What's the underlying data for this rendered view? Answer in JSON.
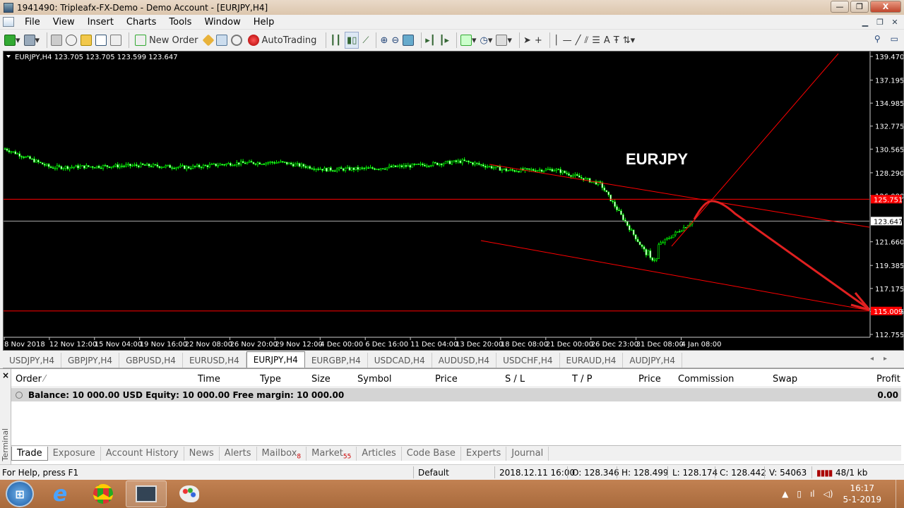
{
  "window": {
    "title": "1941490: Tripleafx-FX-Demo - Demo Account - [EURJPY,H4]",
    "min": "—",
    "max": "❐",
    "close": "X"
  },
  "menu": [
    "File",
    "View",
    "Insert",
    "Charts",
    "Tools",
    "Window",
    "Help"
  ],
  "toolbar": {
    "new_order": "New Order",
    "autotrading": "AutoTrading",
    "text_tool": "A"
  },
  "chart": {
    "header": "EURJPY,H4  123.705 123.705 123.599 123.647",
    "watermark": "EURJPY",
    "price_labels": [
      "139.470",
      "137.195",
      "134.985",
      "132.775",
      "130.565",
      "128.290",
      "126.080",
      "123.647",
      "121.660",
      "119.385",
      "117.175",
      "114.965",
      "112.755"
    ],
    "current_price": "123.647",
    "hline_upper": "125.751",
    "hline_lower": "115.009",
    "time_labels": [
      "8 Nov 2018",
      "12 Nov 12:00",
      "15 Nov 04:00",
      "19 Nov 16:00",
      "22 Nov 08:00",
      "26 Nov 20:00",
      "29 Nov 12:00",
      "4 Dec 00:00",
      "6 Dec 16:00",
      "11 Dec 04:00",
      "13 Dec 20:00",
      "18 Dec 08:00",
      "21 Dec 00:00",
      "26 Dec 23:00",
      "31 Dec 08:00",
      "4 Jan 08:00"
    ],
    "colors": {
      "candles": "#00ff00",
      "lines": "#ff0000",
      "arrow": "#e02020",
      "bg": "#000000"
    }
  },
  "chart_data": {
    "type": "line",
    "title": "EURJPY,H4",
    "ylim": [
      112.755,
      139.47
    ],
    "x": [
      "8 Nov 2018",
      "12 Nov 12:00",
      "15 Nov 04:00",
      "19 Nov 16:00",
      "22 Nov 08:00",
      "26 Nov 20:00",
      "29 Nov 12:00",
      "4 Dec 00:00",
      "6 Dec 16:00",
      "11 Dec 04:00",
      "13 Dec 20:00",
      "18 Dec 08:00",
      "21 Dec 00:00",
      "26 Dec 23:00",
      "31 Dec 08:00",
      "4 Jan 08:00"
    ],
    "series": [
      {
        "values": [
          130.6,
          128.8,
          128.9,
          129.0,
          128.8,
          129.2,
          129.3,
          128.6,
          128.7,
          129.0,
          129.4,
          128.5,
          128.6,
          127.2,
          120.5,
          123.6
        ]
      }
    ],
    "hlines": [
      125.751,
      115.009
    ]
  },
  "symbol_tabs": [
    "USDJPY,H4",
    "GBPJPY,H4",
    "GBPUSD,H4",
    "EURUSD,H4",
    "EURJPY,H4",
    "EURGBP,H4",
    "USDCAD,H4",
    "AUDUSD,H4",
    "USDCHF,H4",
    "EURAUD,H4",
    "AUDJPY,H4"
  ],
  "active_symbol_tab": "EURJPY,H4",
  "terminal": {
    "side_label": "Terminal",
    "columns": {
      "order": "Order",
      "time": "Time",
      "type": "Type",
      "size": "Size",
      "symbol": "Symbol",
      "price": "Price",
      "sl": "S / L",
      "tp": "T / P",
      "price2": "Price",
      "commission": "Commission",
      "swap": "Swap",
      "profit": "Profit"
    },
    "balance_text": "Balance: 10 000.00 USD  Equity: 10 000.00  Free margin: 10 000.00",
    "balance_profit": "0.00",
    "tabs": [
      "Trade",
      "Exposure",
      "Account History",
      "News",
      "Alerts",
      "Mailbox",
      "Market",
      "Articles",
      "Code Base",
      "Experts",
      "Journal"
    ],
    "mailbox_count": "8",
    "market_count": "55"
  },
  "status": {
    "help": "For Help, press F1",
    "profile": "Default",
    "datetime": "2018.12.11 16:00",
    "open": "O: 128.346",
    "high": "H: 128.499",
    "low": "L: 128.174",
    "close": "C: 128.442",
    "volume": "V: 54063",
    "traffic": "48/1 kb"
  },
  "taskbar": {
    "time": "16:17",
    "date": "5-1-2019"
  }
}
